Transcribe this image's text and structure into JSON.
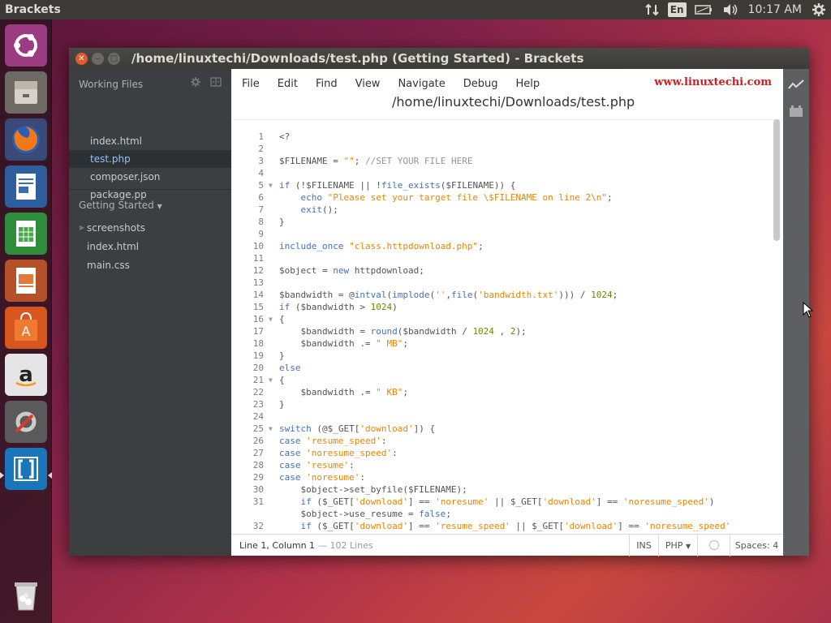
{
  "top_panel": {
    "app_name": "Brackets",
    "lang": "En",
    "time": "10:17 AM"
  },
  "launcher": {
    "items": [
      "ubuntu-dash-icon",
      "files-icon",
      "firefox-icon",
      "writer-icon",
      "calc-icon",
      "impress-icon",
      "software-center-icon",
      "amazon-icon",
      "system-settings-icon",
      "brackets-icon",
      "trash-icon"
    ]
  },
  "window": {
    "title": "/home/linuxtechi/Downloads/test.php (Getting Started) - Brackets"
  },
  "sidebar": {
    "working_files_label": "Working Files",
    "working_files": [
      {
        "name": "index.html",
        "active": false
      },
      {
        "name": "test.php",
        "active": true
      },
      {
        "name": "composer.json",
        "active": false
      },
      {
        "name": "package.pp",
        "active": false
      }
    ],
    "project_label": "Getting Started",
    "tree": [
      {
        "name": "screenshots",
        "folder": true
      },
      {
        "name": "index.html",
        "folder": false
      },
      {
        "name": "main.css",
        "folder": false
      }
    ]
  },
  "menu": [
    "File",
    "Edit",
    "Find",
    "View",
    "Navigate",
    "Debug",
    "Help"
  ],
  "watermark": "www.linuxtechi.com",
  "file_path": "/home/linuxtechi/Downloads/test.php",
  "code": [
    {
      "n": "1",
      "fold": false,
      "html": "&lt;?"
    },
    {
      "n": "2",
      "fold": false,
      "html": ""
    },
    {
      "n": "3",
      "fold": false,
      "html": "$FILENAME = <span class='st'>\"\"</span>; <span class='cm'>//SET YOUR FILE HERE</span>"
    },
    {
      "n": "4",
      "fold": false,
      "html": ""
    },
    {
      "n": "5",
      "fold": true,
      "html": "<span class='kw'>if</span> (!$FILENAME || !<span class='kw'>file_exists</span>($FILENAME)) {"
    },
    {
      "n": "6",
      "fold": false,
      "html": "    <span class='kw'>echo</span> <span class='st'>\"Please set your target file \\$FILENAME on line 2\\n\"</span>;"
    },
    {
      "n": "7",
      "fold": false,
      "html": "    <span class='kw'>exit</span>();"
    },
    {
      "n": "8",
      "fold": false,
      "html": "}"
    },
    {
      "n": "9",
      "fold": false,
      "html": ""
    },
    {
      "n": "10",
      "fold": false,
      "html": "<span class='kw'>include_once</span> <span class='st'>\"class.httpdownload.php\"</span>;"
    },
    {
      "n": "11",
      "fold": false,
      "html": ""
    },
    {
      "n": "12",
      "fold": false,
      "html": "$object = <span class='kw'>new</span> httpdownload;"
    },
    {
      "n": "13",
      "fold": false,
      "html": ""
    },
    {
      "n": "14",
      "fold": false,
      "html": "$bandwidth = @<span class='kw'>intval</span>(<span class='kw'>implode</span>(<span class='st'>''</span>,<span class='kw'>file</span>(<span class='st'>'bandwidth.txt'</span>))) / <span class='num'>1024</span>;"
    },
    {
      "n": "15",
      "fold": false,
      "html": "<span class='kw'>if</span> ($bandwidth &gt; <span class='num'>1024</span>)"
    },
    {
      "n": "16",
      "fold": true,
      "html": "{"
    },
    {
      "n": "17",
      "fold": false,
      "html": "    $bandwidth = <span class='kw'>round</span>($bandwidth / <span class='num'>1024</span> , <span class='num'>2</span>);"
    },
    {
      "n": "18",
      "fold": false,
      "html": "    $bandwidth .= <span class='st'>\" MB\"</span>;"
    },
    {
      "n": "19",
      "fold": false,
      "html": "}"
    },
    {
      "n": "20",
      "fold": false,
      "html": "<span class='kw'>else</span>"
    },
    {
      "n": "21",
      "fold": true,
      "html": "{"
    },
    {
      "n": "22",
      "fold": false,
      "html": "    $bandwidth .= <span class='st'>\" KB\"</span>;"
    },
    {
      "n": "23",
      "fold": false,
      "html": "}"
    },
    {
      "n": "24",
      "fold": false,
      "html": ""
    },
    {
      "n": "25",
      "fold": true,
      "html": "<span class='kw'>switch</span> (@$_GET[<span class='st'>'download'</span>]) {"
    },
    {
      "n": "26",
      "fold": false,
      "html": "<span class='kw'>case</span> <span class='st'>'resume_speed'</span>:"
    },
    {
      "n": "27",
      "fold": false,
      "html": "<span class='kw'>case</span> <span class='st'>'noresume_speed'</span>:"
    },
    {
      "n": "28",
      "fold": false,
      "html": "<span class='kw'>case</span> <span class='st'>'resume'</span>:"
    },
    {
      "n": "29",
      "fold": false,
      "html": "<span class='kw'>case</span> <span class='st'>'noresume'</span>:"
    },
    {
      "n": "30",
      "fold": false,
      "html": "    $object-&gt;set_byfile($FILENAME);"
    },
    {
      "n": "31",
      "fold": false,
      "html": "    <span class='kw'>if</span> ($_GET[<span class='st'>'download'</span>] == <span class='st'>'noresume'</span> || $_GET[<span class='st'>'download'</span>] == <span class='st'>'noresume_speed'</span>)"
    },
    {
      "n": "",
      "fold": false,
      "html": "    $object-&gt;use_resume = <span class='kw'>false</span>;"
    },
    {
      "n": "32",
      "fold": false,
      "html": "    <span class='kw'>if</span> ($_GET[<span class='st'>'download'</span>] == <span class='st'>'resume_speed'</span> || $_GET[<span class='st'>'download'</span>] == <span class='st'>'noresume_speed'</span>"
    }
  ],
  "status": {
    "position": "Line 1, Column 1",
    "lines": "— 102 Lines",
    "mode": "INS",
    "language": "PHP",
    "spaces": "Spaces: 4"
  }
}
